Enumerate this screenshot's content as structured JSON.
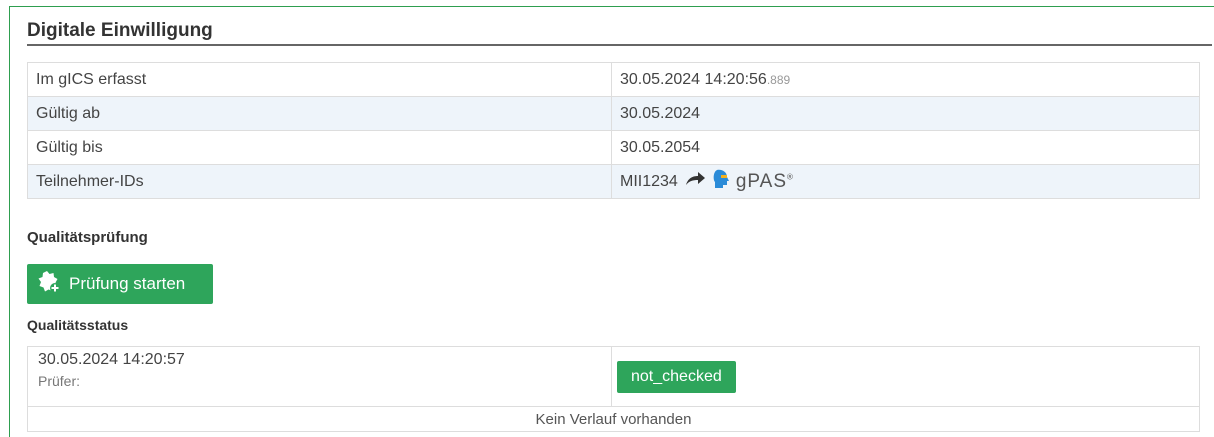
{
  "section": {
    "title": "Digitale Einwilligung"
  },
  "info_rows": [
    {
      "label": "Im gICS erfasst",
      "value": "30.05.2024 14:20:56",
      "value_ms": ".889"
    },
    {
      "label": "Gültig ab",
      "value": "30.05.2024"
    },
    {
      "label": "Gültig bis",
      "value": "30.05.2054"
    },
    {
      "label": "Teilnehmer-IDs",
      "value": "MII1234",
      "gpas": "gPAS",
      "gpas_mark": "®"
    }
  ],
  "quality": {
    "heading": "Qualitätsprüfung",
    "start_button": "Prüfung starten",
    "status_heading": "Qualitätsstatus",
    "status": {
      "timestamp": "30.05.2024 14:20:57",
      "pruefer_label": "Prüfer:",
      "badge": "not_checked",
      "history_empty": "Kein Verlauf vorhanden"
    }
  },
  "colors": {
    "accent": "#2ea55b",
    "panel_border": "#2e9e4f",
    "row_alt": "#eef4fa"
  },
  "icons": {
    "start_button_icon": "badge-plus-icon",
    "link_icon": "arrow-right-icon",
    "gpas_logo": "gpas-logo-icon"
  }
}
